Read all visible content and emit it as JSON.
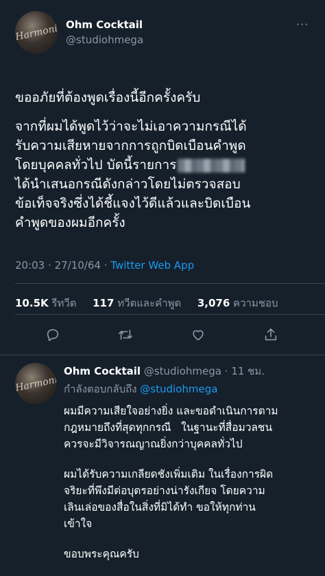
{
  "tweet": {
    "author_name": "Ohm Cocktail",
    "author_handle": "@studiohmega",
    "more_label": "···",
    "paragraph1": [
      "ขออภัยที่ต้องพูดเรื่องนี้อีกครั้งครับ"
    ],
    "paragraph2": [
      "จากที่ผมได้พูดไว้ว่าจะไม่เอาความกรณีได้",
      "รับความเสียหายจากการถูกบิดเบือนคำพูด",
      "โดยบุคคลทั่วไป บัดนี้รายการ",
      "ได้นำเสนอกรณีดังกล่าวโดยไม่ตรวจสอบ",
      "ข้อเท็จจริงซึ่งได้ชี้แจงไว้ดีแล้วและบิดเบือน",
      "คำพูดของผมอีกครั้ง"
    ],
    "time": "20:03",
    "date": "27/10/64",
    "source": "Twitter Web App",
    "separator": "·",
    "retweets_count": "10.5K",
    "retweets_label": "รีทวีต",
    "quotes_count": "117",
    "quotes_label": "ทวีตและคำพูด",
    "likes_count": "3,076",
    "likes_label": "ความชอบ"
  },
  "actions": {
    "icons": [
      "reply-icon",
      "retweet-icon",
      "like-icon",
      "share-icon"
    ]
  },
  "reply": {
    "author_name": "Ohm Cocktail",
    "author_handle": "@studiohmega",
    "time_ago": "11 ชม.",
    "replying_label": "กำลังตอบกลับถึง",
    "replying_to": "@studiohmega",
    "paragraph1": [
      "ผมมีความเสียใจอย่างยิ่ง และขอดำเนินการตาม",
      "กฎหมายถึงที่สุดทุกกรณี   ในฐานะที่สื่อมวลชน",
      "ควรจะมีวิจารณญาณยิ่งกว่าบุคคลทั่วไป"
    ],
    "paragraph2": [
      "ผมได้รับความเกลียดชังเพิ่มเติม ในเรื่องการผิด",
      "จริยะที่พึงมีต่อบุตรอย่างน่ารังเกียจ โดยความ",
      "เลินเล่อของสื่อในสิ่งที่มิได้ทำ ขอให้ทุกท่าน",
      "เข้าใจ"
    ],
    "paragraph3": [
      "ขอบพระคุณครับ"
    ]
  },
  "colors": {
    "background": "#15202b",
    "text": "#ffffff",
    "secondary": "#8b98a5",
    "accent": "#1d9bf0",
    "divider": "#38444d"
  }
}
